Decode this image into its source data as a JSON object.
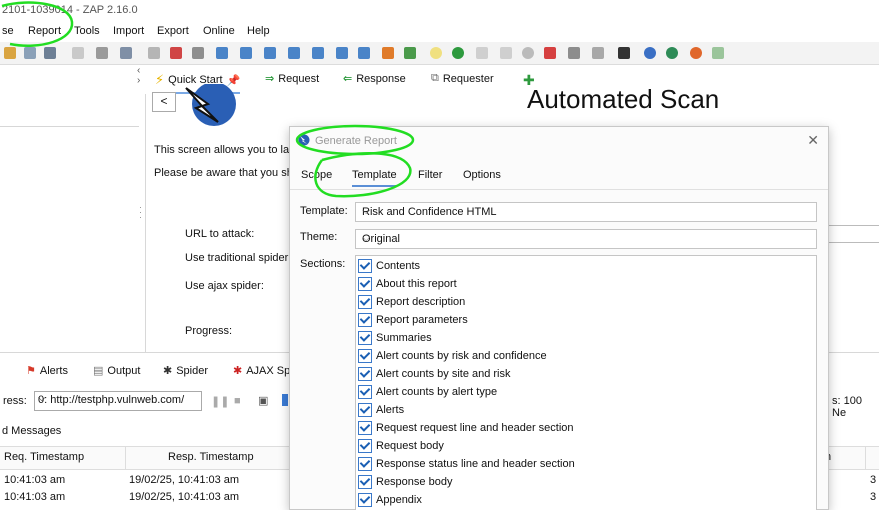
{
  "window": {
    "title": "2101-1039014 - ZAP 2.16.0"
  },
  "menu": [
    "se",
    "Report",
    "Tools",
    "Import",
    "Export",
    "Online",
    "Help"
  ],
  "workspace_tabs": [
    "Quick Start",
    "Request",
    "Response",
    "Requester"
  ],
  "quick_start": {
    "title": "Automated Scan",
    "intro": "This screen allows you to lau",
    "warning": "Please be aware that you sho",
    "url_label": "URL to attack:",
    "trad_spider": "Use traditional spider:",
    "ajax_spider": "Use ajax spider:",
    "progress": "Progress:"
  },
  "bottom_tabs": [
    "Alerts",
    "Output",
    "Spider",
    "AJAX Sp"
  ],
  "progress": {
    "label": "ress:",
    "value": "0: http://testphp.vulnweb.com/",
    "right_text": "s: 100  Ne"
  },
  "messages": {
    "title": "d Messages",
    "headers": [
      "Req. Timestamp",
      "Resp. Timestamp",
      "h"
    ],
    "rows": [
      {
        "req": "10:41:03 am",
        "resp": "19/02/25, 10:41:03 am",
        "extra": "3"
      },
      {
        "req": "10:41:03 am",
        "resp": "19/02/25, 10:41:03 am",
        "extra": "3"
      }
    ]
  },
  "dialog": {
    "title": "Generate Report",
    "tabs": [
      "Scope",
      "Template",
      "Filter",
      "Options"
    ],
    "template_label": "Template:",
    "template_value": "Risk and Confidence HTML",
    "theme_label": "Theme:",
    "theme_value": "Original",
    "sections_label": "Sections:",
    "sections": [
      "Contents",
      "About this report",
      "Report description",
      "Report parameters",
      "Summaries",
      "Alert counts by risk and confidence",
      "Alert counts by site and risk",
      "Alert counts by alert type",
      "Alerts",
      "Request request line and header section",
      "Request body",
      "Response status line and header section",
      "Response body",
      "Appendix"
    ]
  }
}
